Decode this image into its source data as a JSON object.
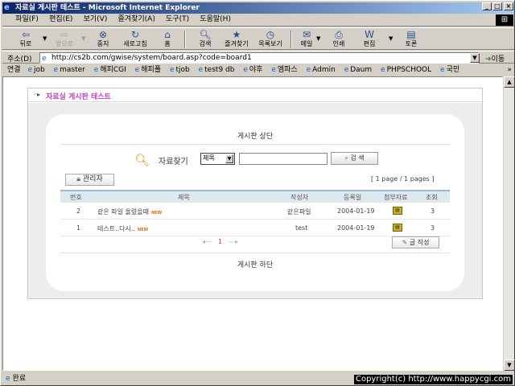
{
  "window": {
    "title": "자료실 게시판 테스트 - Microsoft Internet Explorer"
  },
  "menu": {
    "items": [
      "파일(F)",
      "편집(E)",
      "보기(V)",
      "즐겨찾기(A)",
      "도구(T)",
      "도움말(H)"
    ]
  },
  "toolbar": {
    "back": "뒤로",
    "forward": "앞으로",
    "stop": "중지",
    "refresh": "새로고침",
    "home": "홈",
    "search": "검색",
    "favorites": "즐겨찾기",
    "history": "목록보기",
    "mail": "메일",
    "print": "인쇄",
    "edit": "편집",
    "discuss": "토론"
  },
  "address": {
    "label": "주소(D)",
    "url": "http://cs2b.com/gwise/system/board.asp?code=board1",
    "go": "이동"
  },
  "links": {
    "label": "연결",
    "items": [
      "job",
      "master",
      "해피CGI",
      "해피폴",
      "tjob",
      "test9 db",
      "야후",
      "엠파스",
      "Admin",
      "Daum",
      "PHPSCHOOL",
      "국민"
    ]
  },
  "status": {
    "text": "완료",
    "copyright": "Copyright(c) http://www.happycgi.com"
  },
  "board": {
    "title": "자료실 게시판 테스트",
    "top_caption": "게시판 상단",
    "bottom_caption": "게시판 하단",
    "search": {
      "label": "자료찾기",
      "select_value": "제목",
      "button": "검 색"
    },
    "admin_button": "관리자",
    "page_info": "[ 1 page / 1 pages ]",
    "columns": {
      "no": "번호",
      "subject": "제목",
      "author": "작성자",
      "date": "등록일",
      "attach": "첨부자료",
      "views": "조회"
    },
    "rows": [
      {
        "no": "2",
        "subject": "같은 파일 올렸을때",
        "is_new": true,
        "author": "같은파일",
        "date": "2004-01-19",
        "views": "3"
      },
      {
        "no": "1",
        "subject": "테스트..다시..",
        "is_new": true,
        "author": "test",
        "date": "2004-01-19",
        "views": "3"
      }
    ],
    "new_badge": "NEW",
    "pager": {
      "current": "1"
    },
    "write_button": "글 작성"
  }
}
